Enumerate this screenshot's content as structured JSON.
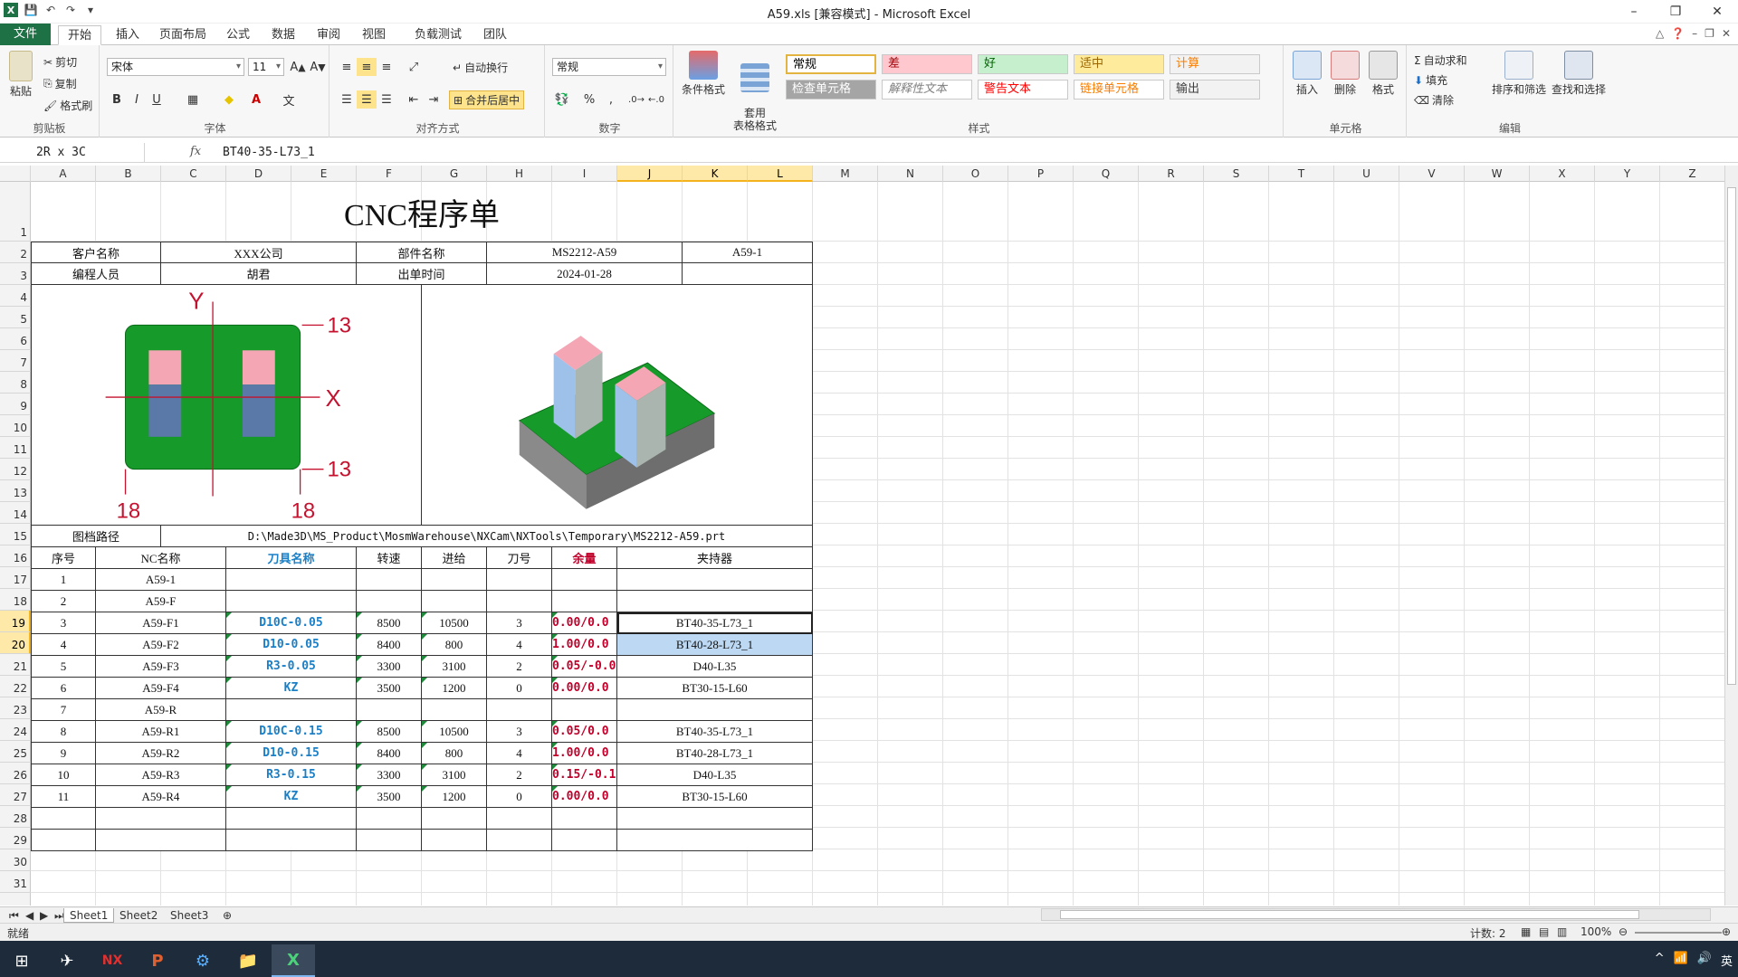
{
  "window": {
    "title": "A59.xls  [兼容模式] - Microsoft Excel"
  },
  "ribbon": {
    "tabs": [
      "文件",
      "开始",
      "插入",
      "页面布局",
      "公式",
      "数据",
      "审阅",
      "视图",
      "负载测试",
      "团队"
    ],
    "clipboard": {
      "label": "剪贴板",
      "paste": "粘贴",
      "cut": "剪切",
      "copy": "复制",
      "format_painter": "格式刷"
    },
    "font": {
      "label": "字体",
      "name": "宋体",
      "size": "11",
      "bold": "B",
      "italic": "I",
      "underline": "U"
    },
    "alignment": {
      "label": "对齐方式",
      "wrap": "自动换行",
      "merge": "合并后居中"
    },
    "number": {
      "label": "数字",
      "format": "常规"
    },
    "styles": {
      "label": "样式",
      "cond_format": "条件格式",
      "table_format": "套用\n表格格式",
      "cells": [
        {
          "text": "常规",
          "bg": "#ffffff",
          "fg": "#000000"
        },
        {
          "text": "差",
          "bg": "#ffc7ce",
          "fg": "#9c0006"
        },
        {
          "text": "好",
          "bg": "#c6efce",
          "fg": "#006100"
        },
        {
          "text": "适中",
          "bg": "#ffeb9c",
          "fg": "#9c6500"
        },
        {
          "text": "计算",
          "bg": "#f2f2f2",
          "fg": "#fa7d00"
        },
        {
          "text": "检查单元格",
          "bg": "#a5a5a5",
          "fg": "#ffffff"
        },
        {
          "text": "解释性文本",
          "bg": "#ffffff",
          "fg": "#7f7f7f"
        },
        {
          "text": "警告文本",
          "bg": "#ffffff",
          "fg": "#ff0000"
        },
        {
          "text": "链接单元格",
          "bg": "#ffffff",
          "fg": "#fa7d00"
        },
        {
          "text": "输出",
          "bg": "#f2f2f2",
          "fg": "#3f3f3f"
        }
      ]
    },
    "cells_group": {
      "label": "单元格",
      "insert": "插入",
      "delete": "删除",
      "format": "格式"
    },
    "editing": {
      "label": "编辑",
      "autosum": "自动求和",
      "fill": "填充",
      "clear": "清除",
      "sort": "排序和筛选",
      "find": "查找和选择"
    }
  },
  "formula_bar": {
    "name_box": "2R x 3C",
    "fx": "fx",
    "formula": "BT40-35-L73_1"
  },
  "columns": [
    "A",
    "B",
    "C",
    "D",
    "E",
    "F",
    "G",
    "H",
    "I",
    "J",
    "K",
    "L",
    "M",
    "N",
    "O",
    "P",
    "Q",
    "R",
    "S",
    "T",
    "U",
    "V",
    "W",
    "X",
    "Y",
    "Z"
  ],
  "selected_columns": [
    "J",
    "K",
    "L"
  ],
  "rows": [
    "1",
    "2",
    "3",
    "4",
    "5",
    "6",
    "7",
    "8",
    "9",
    "10",
    "11",
    "12",
    "13",
    "14",
    "15",
    "16",
    "17",
    "18",
    "19",
    "20",
    "21",
    "22",
    "23",
    "24",
    "25",
    "26",
    "27",
    "28",
    "29",
    "30",
    "31"
  ],
  "selected_rows": [
    "19",
    "20"
  ],
  "sheet": {
    "title": "CNC程序单",
    "info": {
      "customer_label": "客户名称",
      "customer_value": "XXX公司",
      "part_label": "部件名称",
      "part_value": "MS2212-A59",
      "part_code": "A59-1",
      "programmer_label": "编程人员",
      "programmer_value": "胡君",
      "date_label": "出单时间",
      "date_value": "2024-01-28"
    },
    "drawing": {
      "label_y": "Y",
      "label_x": "X",
      "dim_top_right": "13",
      "dim_bottom_right": "13",
      "dim_bottom_left": "18",
      "dim_bottom_mid": "18"
    },
    "path_label": "图档路径",
    "path_value": "D:\\Made3D\\MS_Product\\MosmWarehouse\\NXCam\\NXTools\\Temporary\\MS2212-A59.prt",
    "table_headers": [
      "序号",
      "NC名称",
      "刀具名称",
      "转速",
      "进给",
      "刀号",
      "余量",
      "夹持器"
    ],
    "table_rows": [
      [
        "1",
        "A59-1",
        "",
        "",
        "",
        "",
        "",
        ""
      ],
      [
        "2",
        "A59-F",
        "",
        "",
        "",
        "",
        "",
        ""
      ],
      [
        "3",
        "A59-F1",
        "D10C-0.05",
        "8500",
        "10500",
        "3",
        "0.00/0.0",
        "BT40-35-L73_1"
      ],
      [
        "4",
        "A59-F2",
        "D10-0.05",
        "8400",
        "800",
        "4",
        "1.00/0.0",
        "BT40-28-L73_1"
      ],
      [
        "5",
        "A59-F3",
        "R3-0.05",
        "3300",
        "3100",
        "2",
        "0.05/-0.0",
        "D40-L35"
      ],
      [
        "6",
        "A59-F4",
        "KZ",
        "3500",
        "1200",
        "0",
        "0.00/0.0",
        "BT30-15-L60"
      ],
      [
        "7",
        "A59-R",
        "",
        "",
        "",
        "",
        "",
        ""
      ],
      [
        "8",
        "A59-R1",
        "D10C-0.15",
        "8500",
        "10500",
        "3",
        "0.05/0.0",
        "BT40-35-L73_1"
      ],
      [
        "9",
        "A59-R2",
        "D10-0.15",
        "8400",
        "800",
        "4",
        "1.00/0.0",
        "BT40-28-L73_1"
      ],
      [
        "10",
        "A59-R3",
        "R3-0.15",
        "3300",
        "3100",
        "2",
        "0.15/-0.1",
        "D40-L35"
      ],
      [
        "11",
        "A59-R4",
        "KZ",
        "3500",
        "1200",
        "0",
        "0.00/0.0",
        "BT30-15-L60"
      ],
      [
        "",
        "",
        "",
        "",
        "",
        "",
        "",
        ""
      ],
      [
        "",
        "",
        "",
        "",
        "",
        "",
        "",
        ""
      ]
    ]
  },
  "sheet_tabs": [
    "Sheet1",
    "Sheet2",
    "Sheet3"
  ],
  "status": {
    "mode": "就绪",
    "count": "计数: 2",
    "zoom": "100%"
  },
  "taskbar": {
    "lang": "英"
  }
}
